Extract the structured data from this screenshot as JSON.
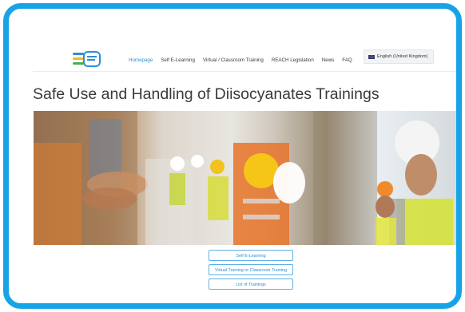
{
  "nav": {
    "items": [
      {
        "label": "Homepage",
        "active": true
      },
      {
        "label": "Self E-Learning",
        "active": false
      },
      {
        "label": "Virtual / Classroom Training",
        "active": false
      },
      {
        "label": "REACH Legislation",
        "active": false
      },
      {
        "label": "News",
        "active": false
      },
      {
        "label": "FAQ",
        "active": false
      }
    ],
    "language": "English (United Kingdom)"
  },
  "page": {
    "title": "Safe Use and Handling of Diisocyanates Trainings"
  },
  "hero": {
    "description_icon": "workers-collage-image"
  },
  "buttons": {
    "self_elearning": "Self E-Learning",
    "virtual_training": "Virtual Training or Classroom Training",
    "list_trainings": "List of Trainings"
  },
  "colors": {
    "frame": "#16a4e6",
    "accent": "#2b8fd6"
  }
}
